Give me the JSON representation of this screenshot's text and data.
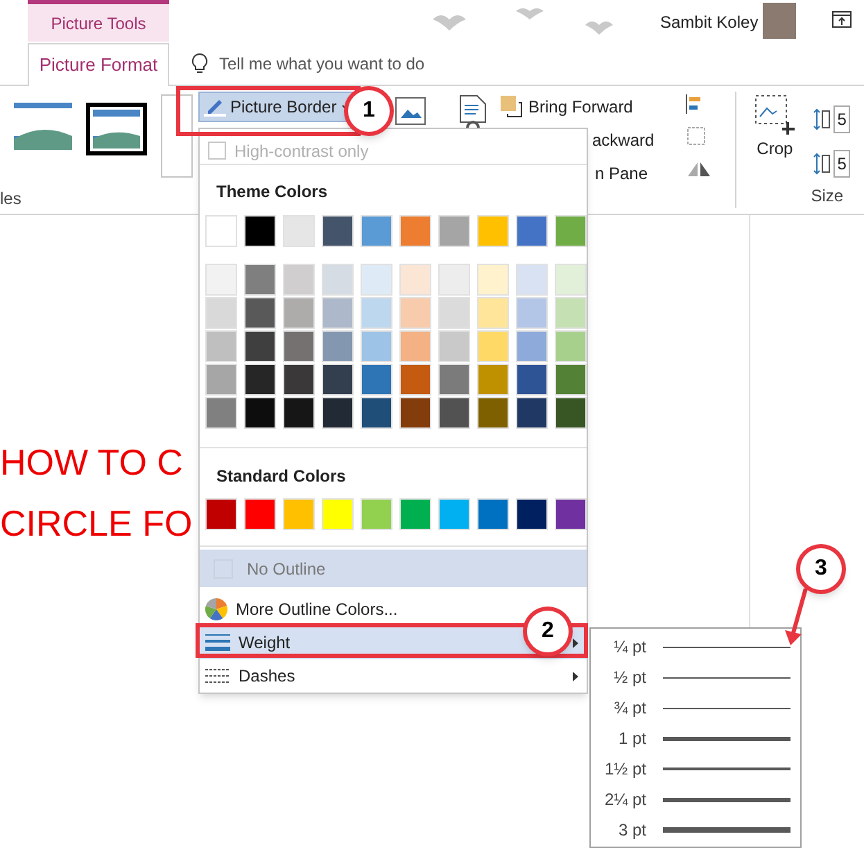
{
  "context_tab": {
    "label": "Picture Tools"
  },
  "account": {
    "name": "Sambit Koley"
  },
  "tabs": [
    {
      "label": "Picture Format",
      "selected": true
    }
  ],
  "tell_me": {
    "placeholder": "Tell me what you want to do"
  },
  "ribbon": {
    "left_group_label": "les",
    "picture_border": {
      "label": "Picture Border"
    },
    "bring_forward": "Bring Forward",
    "send_backward": "ackward",
    "selection_pane": "n Pane",
    "crop": "Crop",
    "size_fields": [
      "5",
      "5"
    ],
    "size_group_label": "Size"
  },
  "document": {
    "lines": [
      "HOW TO C",
      "CIRCLE FO"
    ]
  },
  "menu": {
    "high_contrast": {
      "label": "High-contrast only",
      "checked": false,
      "disabled": true
    },
    "theme_colors": {
      "label": "Theme Colors",
      "base": [
        {
          "color": "#ffffff"
        },
        {
          "color": "#000000"
        },
        {
          "color": "#e7e6e6"
        },
        {
          "color": "#44546a"
        },
        {
          "color": "#5b9bd5"
        },
        {
          "color": "#ed7d31"
        },
        {
          "color": "#a5a5a5"
        },
        {
          "color": "#ffc000"
        },
        {
          "color": "#4472c4"
        },
        {
          "color": "#70ad47"
        }
      ],
      "shades": [
        [
          {
            "color": "#f2f2f2"
          },
          {
            "color": "#7f7f7f"
          },
          {
            "color": "#d0cece"
          },
          {
            "color": "#d6dce4"
          },
          {
            "color": "#deebf6"
          },
          {
            "color": "#fbe5d5"
          },
          {
            "color": "#ededed"
          },
          {
            "color": "#fff2cc"
          },
          {
            "color": "#d9e2f3"
          },
          {
            "color": "#e2efd9"
          }
        ],
        [
          {
            "color": "#d9d9d9"
          },
          {
            "color": "#595959"
          },
          {
            "color": "#aeabab"
          },
          {
            "color": "#adb9ca"
          },
          {
            "color": "#bdd7ee"
          },
          {
            "color": "#f7cbac"
          },
          {
            "color": "#dbdbdb"
          },
          {
            "color": "#fee599"
          },
          {
            "color": "#b4c6e7"
          },
          {
            "color": "#c5e0b3"
          }
        ],
        [
          {
            "color": "#bfbfbf"
          },
          {
            "color": "#3f3f3f"
          },
          {
            "color": "#757171"
          },
          {
            "color": "#8497b0"
          },
          {
            "color": "#9dc3e6"
          },
          {
            "color": "#f4b183"
          },
          {
            "color": "#c9c9c9"
          },
          {
            "color": "#ffd965"
          },
          {
            "color": "#8eaadb"
          },
          {
            "color": "#a8d08d"
          }
        ],
        [
          {
            "color": "#a6a6a6"
          },
          {
            "color": "#262626"
          },
          {
            "color": "#3a3838"
          },
          {
            "color": "#333f4f"
          },
          {
            "color": "#2e75b5"
          },
          {
            "color": "#c55a11"
          },
          {
            "color": "#7b7b7b"
          },
          {
            "color": "#bf9000"
          },
          {
            "color": "#2f5496"
          },
          {
            "color": "#538135"
          }
        ],
        [
          {
            "color": "#808080"
          },
          {
            "color": "#0d0d0d"
          },
          {
            "color": "#171616"
          },
          {
            "color": "#222a35"
          },
          {
            "color": "#1f4e79"
          },
          {
            "color": "#833c0b"
          },
          {
            "color": "#525252"
          },
          {
            "color": "#7f6000"
          },
          {
            "color": "#1f3864"
          },
          {
            "color": "#375623"
          }
        ]
      ]
    },
    "standard_colors": {
      "label": "Standard Colors",
      "swatches": [
        {
          "color": "#c00000"
        },
        {
          "color": "#ff0000"
        },
        {
          "color": "#ffc000"
        },
        {
          "color": "#ffff00"
        },
        {
          "color": "#92d050"
        },
        {
          "color": "#00b050"
        },
        {
          "color": "#00b0f0"
        },
        {
          "color": "#0070c0"
        },
        {
          "color": "#002060"
        },
        {
          "color": "#7030a0"
        }
      ]
    },
    "items": [
      {
        "kind": "no-outline",
        "label": "No Outline",
        "selected": true,
        "disabled": true
      },
      {
        "kind": "more-colors",
        "label": "More Outline Colors...",
        "selected": false,
        "disabled": false
      },
      {
        "kind": "weight",
        "label": "Weight",
        "selected": true,
        "disabled": false,
        "submenu": true
      },
      {
        "kind": "dashes",
        "label": "Dashes",
        "selected": false,
        "disabled": false,
        "submenu": true
      }
    ]
  },
  "weight_submenu": [
    {
      "label": "¼ pt",
      "kind": "hairline"
    },
    {
      "label": "½ pt",
      "kind": "hairline"
    },
    {
      "label": "¾ pt",
      "kind": "hairline"
    },
    {
      "label": "1 pt",
      "kind": "medium"
    },
    {
      "label": "1½ pt",
      "kind": "thin"
    },
    {
      "label": "2¼ pt",
      "kind": "thick"
    },
    {
      "label": "3 pt",
      "kind": "heavy"
    }
  ],
  "callouts": [
    {
      "label": "1"
    },
    {
      "label": "2"
    },
    {
      "label": "3"
    }
  ]
}
